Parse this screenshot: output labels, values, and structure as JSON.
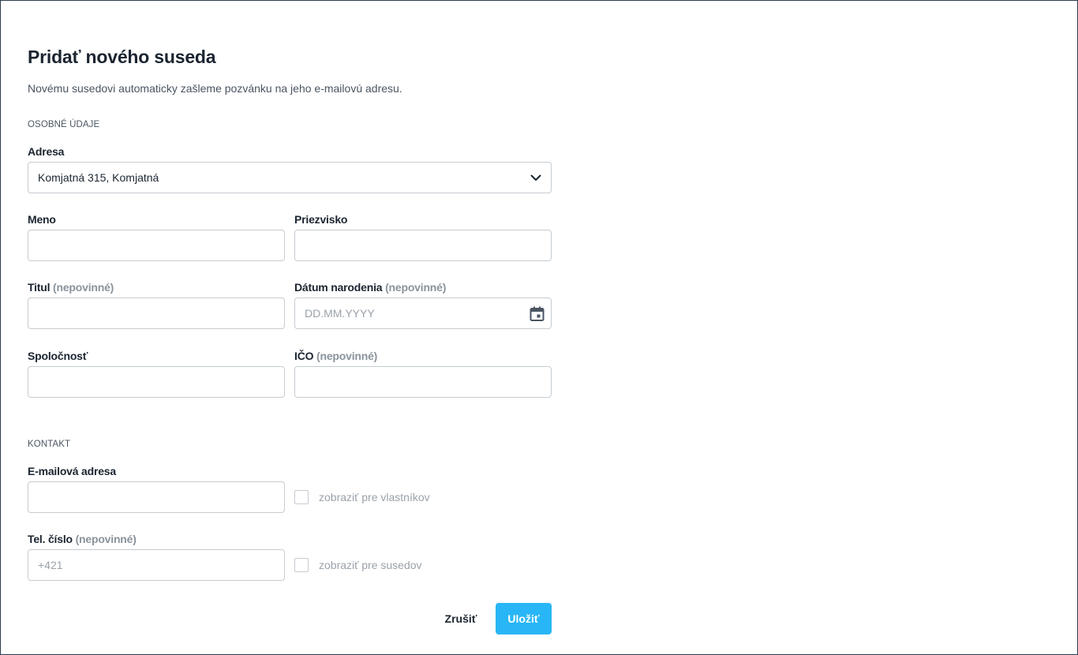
{
  "dialog": {
    "title": "Pridať nového suseda",
    "subtitle": "Novému susedovi automaticky zašleme pozvánku na jeho e-mailovú adresu."
  },
  "sections": {
    "personal": "OSOBNÉ ÚDAJE",
    "contact": "KONTAKT"
  },
  "fields": {
    "address": {
      "label": "Adresa",
      "value": "Komjatná 315, Komjatná"
    },
    "first_name": {
      "label": "Meno",
      "value": ""
    },
    "last_name": {
      "label": "Priezvisko",
      "value": ""
    },
    "title": {
      "label": "Titul",
      "optional": "(nepovinné)",
      "value": ""
    },
    "birth_date": {
      "label": "Dátum narodenia",
      "optional": "(nepovinné)",
      "placeholder": "DD.MM.YYYY",
      "value": ""
    },
    "company": {
      "label": "Spoločnosť",
      "value": ""
    },
    "ico": {
      "label": "IČO",
      "optional": "(nepovinné)",
      "value": ""
    },
    "email": {
      "label": "E-mailová adresa",
      "value": "",
      "checkbox_label": "zobraziť pre vlastníkov",
      "checked": false
    },
    "phone": {
      "label": "Tel. číslo",
      "optional": "(nepovinné)",
      "placeholder": "+421",
      "value": "",
      "checkbox_label": "zobraziť pre susedov",
      "checked": false
    }
  },
  "buttons": {
    "cancel": "Zrušiť",
    "save": "Uložiť"
  },
  "colors": {
    "primary": "#29b6f6",
    "text": "#1b2530",
    "muted": "#8a939c",
    "border": "#c6ccd2"
  },
  "icons": {
    "select_arrow": "chevron-down-icon",
    "date_picker": "calendar-icon"
  }
}
